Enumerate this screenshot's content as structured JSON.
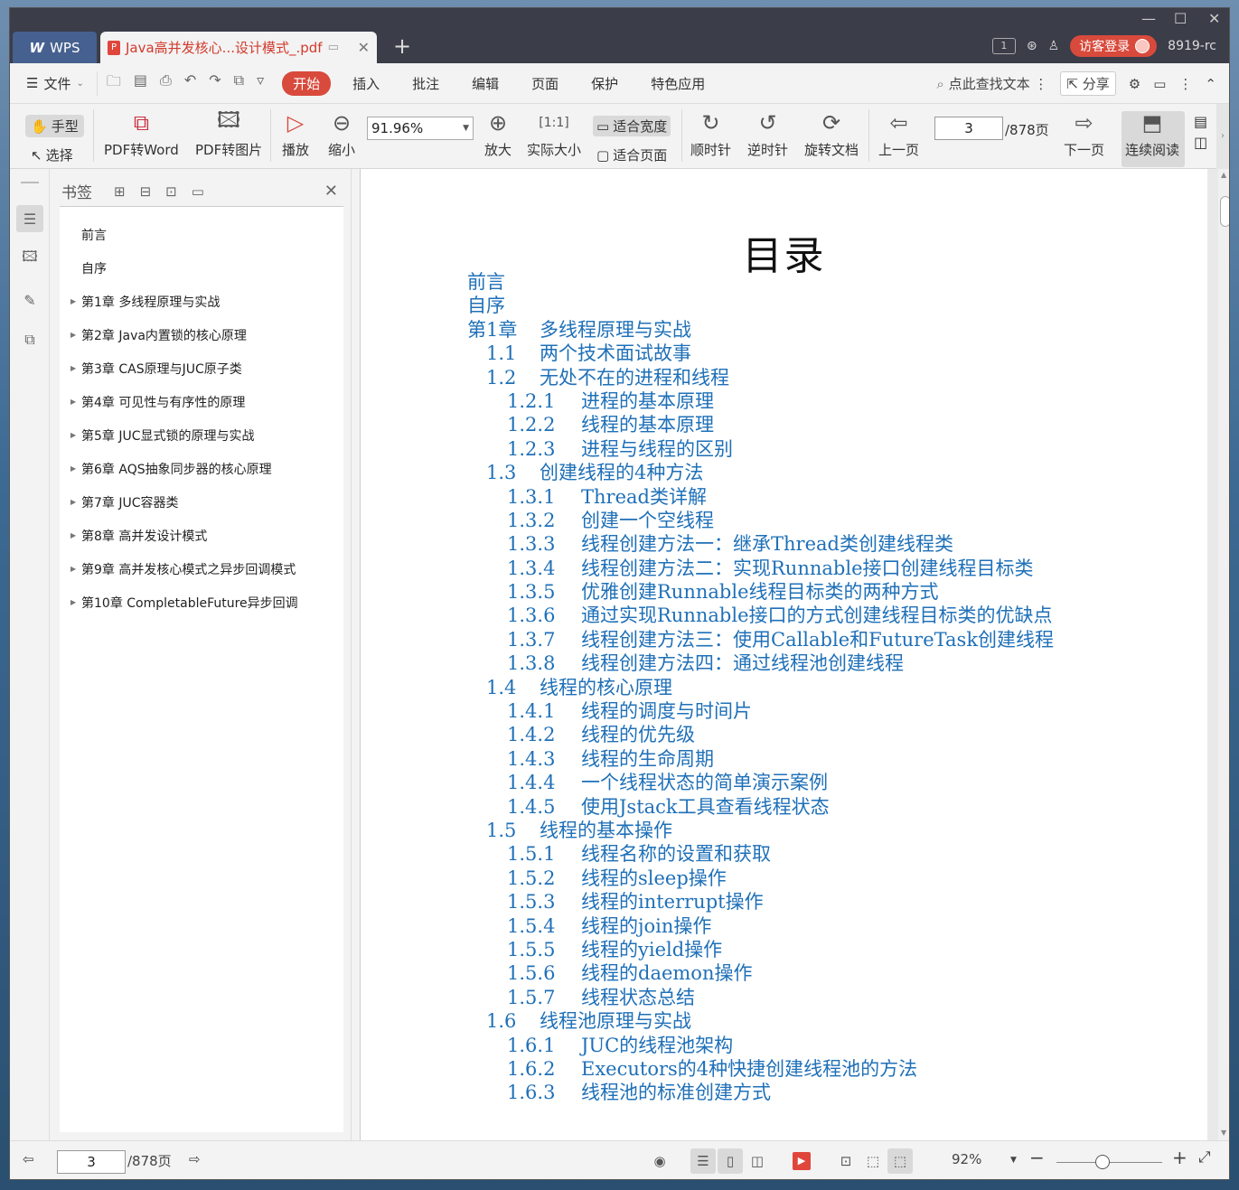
{
  "titlebar": {
    "app_tab": "WPS",
    "doc_tab_title": "Java高并发核心...设计模式_.pdf",
    "tab_count": "1",
    "login_label": "访客登录",
    "user_id": "8919-rc"
  },
  "menu": {
    "file": "文件",
    "items": [
      "开始",
      "插入",
      "批注",
      "编辑",
      "页面",
      "保护",
      "特色应用"
    ],
    "search_label": "点此查找文本",
    "share_label": "分享"
  },
  "ribbon": {
    "hand": "手型",
    "select": "选择",
    "pdf_to_word": "PDF转Word",
    "pdf_to_image": "PDF转图片",
    "play": "播放",
    "zoom_out": "缩小",
    "zoom_value": "91.96%",
    "zoom_in": "放大",
    "actual_size": "实际大小",
    "fit_width": "适合宽度",
    "fit_page": "适合页面",
    "clockwise": "顺时针",
    "counterclockwise": "逆时针",
    "rotate_doc": "旋转文档",
    "prev_page": "上一页",
    "page_current": "3",
    "page_total": "/878页",
    "next_page": "下一页",
    "continuous_read": "连续阅读"
  },
  "bookmarks": {
    "title": "书签",
    "items": [
      {
        "label": "前言",
        "expandable": false
      },
      {
        "label": "自序",
        "expandable": false
      },
      {
        "label": "第1章 多线程原理与实战",
        "expandable": true
      },
      {
        "label": "第2章 Java内置锁的核心原理",
        "expandable": true
      },
      {
        "label": "第3章 CAS原理与JUC原子类",
        "expandable": true
      },
      {
        "label": "第4章 可见性与有序性的原理",
        "expandable": true
      },
      {
        "label": "第5章 JUC显式锁的原理与实战",
        "expandable": true
      },
      {
        "label": "第6章 AQS抽象同步器的核心原理",
        "expandable": true
      },
      {
        "label": "第7章 JUC容器类",
        "expandable": true
      },
      {
        "label": "第8章 高并发设计模式",
        "expandable": true
      },
      {
        "label": "第9章 高并发核心模式之异步回调模式",
        "expandable": true
      },
      {
        "label": "第10章 CompletableFuture异步回调",
        "expandable": true
      }
    ]
  },
  "document": {
    "title": "目录",
    "toc": [
      {
        "level": 1,
        "num": "",
        "text": "前言"
      },
      {
        "level": 1,
        "num": "",
        "text": "自序"
      },
      {
        "level": 1,
        "num": "第1章",
        "text": "多线程原理与实战"
      },
      {
        "level": 2,
        "num": "1.1",
        "text": "两个技术面试故事"
      },
      {
        "level": 2,
        "num": "1.2",
        "text": "无处不在的进程和线程"
      },
      {
        "level": 3,
        "num": "1.2.1",
        "text": "进程的基本原理"
      },
      {
        "level": 3,
        "num": "1.2.2",
        "text": "线程的基本原理"
      },
      {
        "level": 3,
        "num": "1.2.3",
        "text": "进程与线程的区别"
      },
      {
        "level": 2,
        "num": "1.3",
        "text": "创建线程的4种方法"
      },
      {
        "level": 3,
        "num": "1.3.1",
        "text": "Thread类详解"
      },
      {
        "level": 3,
        "num": "1.3.2",
        "text": "创建一个空线程"
      },
      {
        "level": 3,
        "num": "1.3.3",
        "text": "线程创建方法一：继承Thread类创建线程类"
      },
      {
        "level": 3,
        "num": "1.3.4",
        "text": "线程创建方法二：实现Runnable接口创建线程目标类"
      },
      {
        "level": 3,
        "num": "1.3.5",
        "text": "优雅创建Runnable线程目标类的两种方式"
      },
      {
        "level": 3,
        "num": "1.3.6",
        "text": "通过实现Runnable接口的方式创建线程目标类的优缺点"
      },
      {
        "level": 3,
        "num": "1.3.7",
        "text": "线程创建方法三：使用Callable和FutureTask创建线程"
      },
      {
        "level": 3,
        "num": "1.3.8",
        "text": "线程创建方法四：通过线程池创建线程"
      },
      {
        "level": 2,
        "num": "1.4",
        "text": "线程的核心原理"
      },
      {
        "level": 3,
        "num": "1.4.1",
        "text": "线程的调度与时间片"
      },
      {
        "level": 3,
        "num": "1.4.2",
        "text": "线程的优先级"
      },
      {
        "level": 3,
        "num": "1.4.3",
        "text": "线程的生命周期"
      },
      {
        "level": 3,
        "num": "1.4.4",
        "text": "一个线程状态的简单演示案例"
      },
      {
        "level": 3,
        "num": "1.4.5",
        "text": "使用Jstack工具查看线程状态"
      },
      {
        "level": 2,
        "num": "1.5",
        "text": "线程的基本操作"
      },
      {
        "level": 3,
        "num": "1.5.1",
        "text": "线程名称的设置和获取"
      },
      {
        "level": 3,
        "num": "1.5.2",
        "text": "线程的sleep操作"
      },
      {
        "level": 3,
        "num": "1.5.3",
        "text": "线程的interrupt操作"
      },
      {
        "level": 3,
        "num": "1.5.4",
        "text": "线程的join操作"
      },
      {
        "level": 3,
        "num": "1.5.5",
        "text": "线程的yield操作"
      },
      {
        "level": 3,
        "num": "1.5.6",
        "text": "线程的daemon操作"
      },
      {
        "level": 3,
        "num": "1.5.7",
        "text": "线程状态总结"
      },
      {
        "level": 2,
        "num": "1.6",
        "text": "线程池原理与实战"
      },
      {
        "level": 3,
        "num": "1.6.1",
        "text": "JUC的线程池架构"
      },
      {
        "level": 3,
        "num": "1.6.2",
        "text": "Executors的4种快捷创建线程池的方法"
      },
      {
        "level": 3,
        "num": "1.6.3",
        "text": "线程池的标准创建方式"
      }
    ]
  },
  "statusbar": {
    "page_current": "3",
    "page_total": "/878页",
    "zoom_percent": "92%"
  },
  "colors": {
    "accent_red": "#d84a3c",
    "toc_blue": "#1f70b8",
    "titlebar_bg": "#3b3d49"
  }
}
